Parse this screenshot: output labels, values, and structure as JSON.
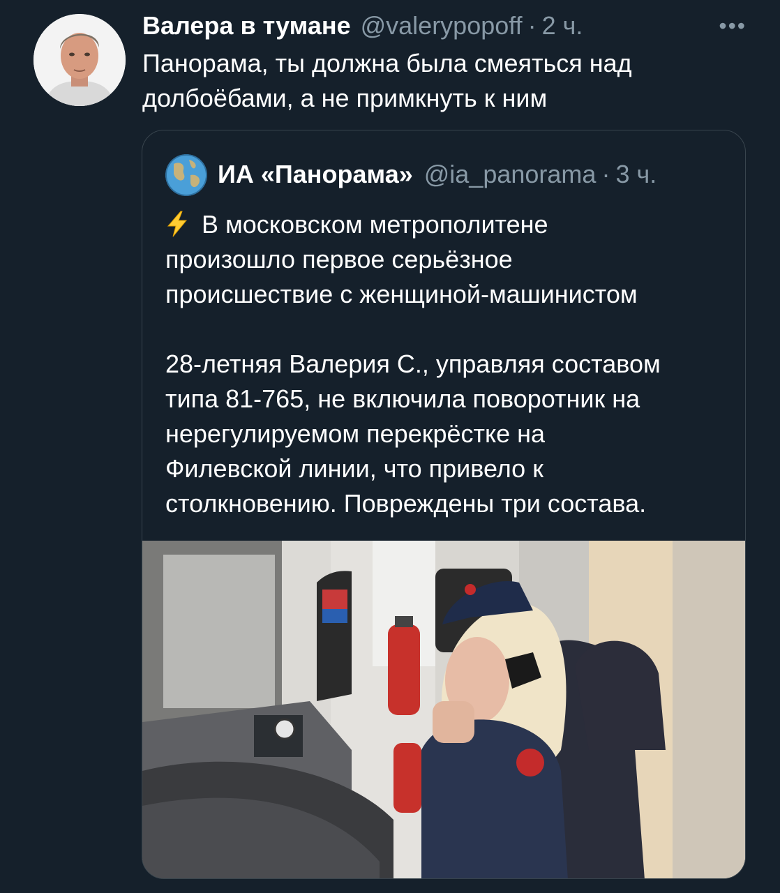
{
  "tweet": {
    "author_name": "Валера в тумане",
    "author_handle": "@valerypopoff",
    "separator": "·",
    "time": "2 ч.",
    "more_icon": "more-icon",
    "more_label": "•••",
    "text": "Панорама, ты должна была смеяться над\nдолбоёбами, а не примкнуть к ним"
  },
  "quoted_tweet": {
    "author_name": "ИА «Панорама»",
    "author_handle": "@ia_panorama",
    "separator": "·",
    "time": "3 ч.",
    "avatar_icon": "globe-icon",
    "lead_icon": "lightning-bolt-icon",
    "text": "В московском метрополитене\nпроизошло первое серьёзное\nпроисшествие с женщиной-машинистом\n\n28-летняя Валерия С., управляя составом\nтипа 81-765, не включила поворотник на\nнерегулируемом перекрёстке на\nФилевской линии, что привело к\nстолкновению. Повреждены три состава.",
    "image_icon": "photo-icon"
  },
  "colors": {
    "background": "#15202b",
    "border": "#38444d",
    "secondary_text": "#8899a6",
    "primary_text": "#ffffff"
  }
}
